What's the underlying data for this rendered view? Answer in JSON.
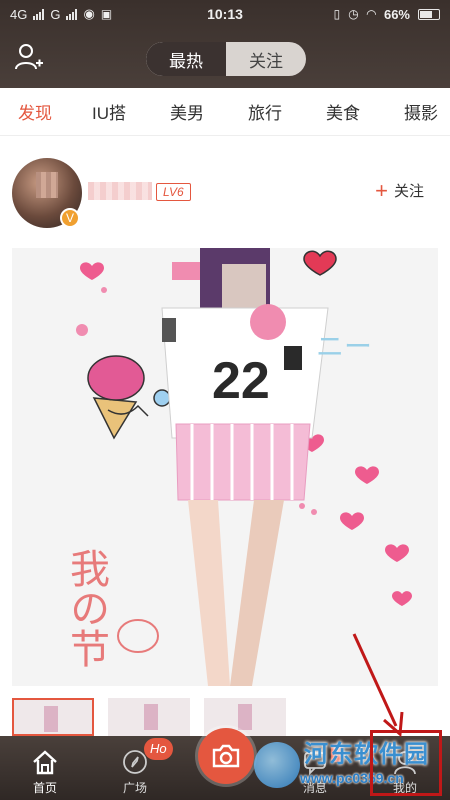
{
  "status_bar": {
    "network_1": "4G",
    "network_2": "G",
    "time": "10:13",
    "battery": "66%"
  },
  "header": {
    "tabs": [
      {
        "label": "最热",
        "active": true
      },
      {
        "label": "关注",
        "active": false
      }
    ],
    "left_icon": "add-user-icon"
  },
  "categories": [
    {
      "label": "发现",
      "active": true
    },
    {
      "label": "IU搭",
      "active": false
    },
    {
      "label": "美男",
      "active": false
    },
    {
      "label": "旅行",
      "active": false
    },
    {
      "label": "美食",
      "active": false
    },
    {
      "label": "摄影",
      "active": false
    }
  ],
  "post": {
    "level": "LV6",
    "verified_badge": "V",
    "follow_plus": "+",
    "follow_label": "关注",
    "photo_text": {
      "jersey_number": "22",
      "handwriting": "我の节"
    }
  },
  "tab_bar": {
    "items": [
      {
        "label": "首页",
        "icon": "home-icon",
        "active": true
      },
      {
        "label": "广场",
        "icon": "compass-icon",
        "active": false
      },
      {
        "label": "",
        "icon": "camera-icon",
        "active": false
      },
      {
        "label": "消息",
        "icon": "message-icon",
        "active": false
      },
      {
        "label": "我的",
        "icon": "person-icon",
        "active": false
      }
    ],
    "hot_badge": "Ho"
  },
  "watermark": {
    "line1": "河东软件园",
    "line2": "www.pc0359.cn"
  },
  "colors": {
    "accent": "#e4573f",
    "header_bg": "#3b3230",
    "annotation": "#c01818"
  }
}
